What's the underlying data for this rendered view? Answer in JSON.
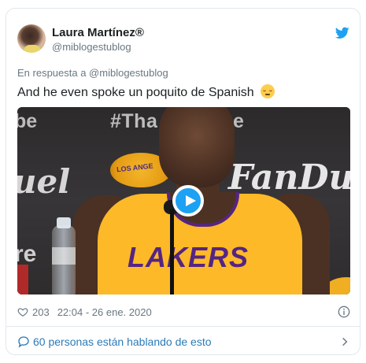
{
  "tweet": {
    "author_name": "Laura Martínez®",
    "author_handle": "@miblogestublog",
    "reply_context": "En respuesta a @miblogestublog",
    "text": "And he even spoke un poquito de Spanish",
    "emoji": "relieved-face-emoji",
    "likes": "203",
    "timestamp": "22:04 - 26 ene. 2020",
    "conversation_link": "60 personas están hablando de esto"
  },
  "media": {
    "hashtag": "#Tha    uKobe",
    "left_text_top": "be",
    "left_text_mid": "uel",
    "left_text_low": "re",
    "sponsor": "FanDu",
    "team_logo_text": "LOS ANGE",
    "jersey_text": "LAKERS",
    "play_icon": "play-icon"
  },
  "icons": {
    "brand": "twitter-bird-icon",
    "like": "heart-icon",
    "info": "info-icon",
    "conversation": "speech-bubble-icon",
    "chevron": "chevron-right-icon"
  },
  "colors": {
    "accent": "#1da1f2",
    "link": "#2b7bb9",
    "muted": "#697882",
    "jersey_gold": "#fdb927",
    "jersey_purple": "#552583"
  }
}
